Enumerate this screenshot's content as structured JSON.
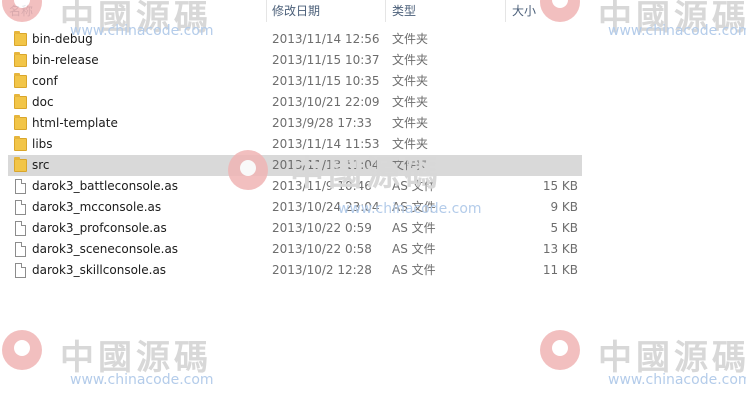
{
  "columns": {
    "name": "名称",
    "date": "修改日期",
    "type": "类型",
    "size": "大小"
  },
  "files": [
    {
      "name": "bin-debug",
      "date": "2013/11/14 12:56",
      "type": "文件夹",
      "size": "",
      "kind": "folder-icon"
    },
    {
      "name": "bin-release",
      "date": "2013/11/15 10:37",
      "type": "文件夹",
      "size": "",
      "kind": "folder-icon"
    },
    {
      "name": "conf",
      "date": "2013/11/15 10:35",
      "type": "文件夹",
      "size": "",
      "kind": "folder-icon"
    },
    {
      "name": "doc",
      "date": "2013/10/21 22:09",
      "type": "文件夹",
      "size": "",
      "kind": "folder-icon"
    },
    {
      "name": "html-template",
      "date": "2013/9/28 17:33",
      "type": "文件夹",
      "size": "",
      "kind": "folder-icon"
    },
    {
      "name": "libs",
      "date": "2013/11/14 11:53",
      "type": "文件夹",
      "size": "",
      "kind": "folder-icon"
    },
    {
      "name": "src",
      "date": "2013/11/13 11:04",
      "type": "文件夹",
      "size": "",
      "kind": "folder-icon",
      "selected": true
    },
    {
      "name": "darok3_battleconsole.as",
      "date": "2013/11/9 10:46",
      "type": "AS 文件",
      "size": "15 KB",
      "kind": "file-icon"
    },
    {
      "name": "darok3_mcconsole.as",
      "date": "2013/10/24 23:04",
      "type": "AS 文件",
      "size": "9 KB",
      "kind": "file-icon"
    },
    {
      "name": "darok3_profconsole.as",
      "date": "2013/10/22 0:59",
      "type": "AS 文件",
      "size": "5 KB",
      "kind": "file-icon"
    },
    {
      "name": "darok3_sceneconsole.as",
      "date": "2013/10/22 0:58",
      "type": "AS 文件",
      "size": "13 KB",
      "kind": "file-icon"
    },
    {
      "name": "darok3_skillconsole.as",
      "date": "2013/10/2 12:28",
      "type": "AS 文件",
      "size": "11 KB",
      "kind": "file-icon"
    }
  ],
  "watermark": {
    "text": "中國源碼",
    "url": "www.chinacode.com"
  },
  "colors": {
    "header_text": "#4c607a",
    "selection": "#d9d9d9",
    "folder": "#f2c548"
  }
}
